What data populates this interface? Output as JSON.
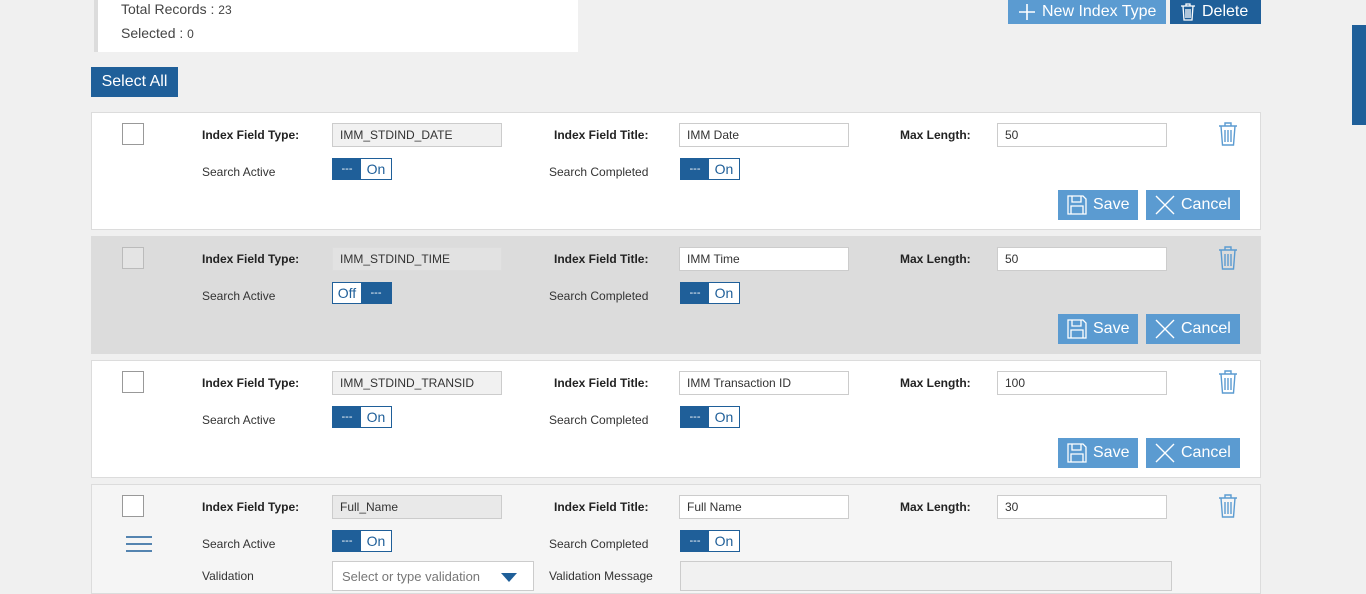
{
  "summary": {
    "total_label": "Total Records :",
    "total_value": "23",
    "selected_label": "Selected :",
    "selected_value": "0"
  },
  "toolbar": {
    "new_label": "New Index Type",
    "delete_label": "Delete",
    "select_all_label": "Select All"
  },
  "labels": {
    "field_type": "Index Field Type:",
    "field_title": "Index Field Title:",
    "max_length": "Max Length:",
    "search_active": "Search Active",
    "search_completed": "Search Completed",
    "save": "Save",
    "cancel": "Cancel",
    "validation": "Validation",
    "validation_message": "Validation Message",
    "validation_placeholder": "Select or type validation",
    "toggle_dash": "---"
  },
  "records": [
    {
      "type": "IMM_STDIND_DATE",
      "title": "IMM Date",
      "max_length": "50",
      "search_active": "On",
      "search_completed": "On"
    },
    {
      "type": "IMM_STDIND_TIME",
      "title": "IMM Time",
      "max_length": "50",
      "search_active": "Off",
      "search_completed": "On"
    },
    {
      "type": "IMM_STDIND_TRANSID",
      "title": "IMM Transaction ID",
      "max_length": "100",
      "search_active": "On",
      "search_completed": "On"
    },
    {
      "type": "Full_Name",
      "title": "Full Name",
      "max_length": "30",
      "search_active": "On",
      "search_completed": "On"
    }
  ],
  "colors": {
    "primary": "#1f5f99",
    "secondary": "#5b9bd1"
  }
}
